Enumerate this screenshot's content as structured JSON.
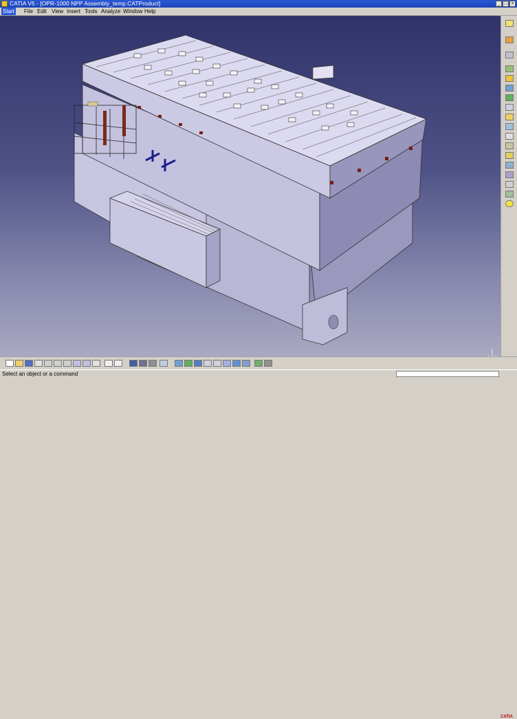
{
  "window": {
    "title": "CATIA V5 - [OPR-1000 NPP Assembly_temp.CATProduct]",
    "buttons": [
      "_",
      "□",
      "×"
    ]
  },
  "menu": [
    {
      "label": "Start"
    },
    {
      "label": "File"
    },
    {
      "label": "Edit"
    },
    {
      "label": "View"
    },
    {
      "label": "Insert"
    },
    {
      "label": "Tools"
    },
    {
      "label": "Analyze"
    },
    {
      "label": "Window"
    },
    {
      "label": "Help"
    }
  ],
  "status": {
    "message": "Select an object or a command",
    "command_input": ""
  },
  "branding": {
    "logo_text": "CATIA"
  },
  "colors": {
    "viewport_top": "#30336a",
    "viewport_bottom": "#a9a9c2",
    "titlebar": "#1d44b8"
  },
  "right_toolbar_icons": [
    "select-icon",
    "sketcher-icon",
    "manipulate-icon",
    "move-icon",
    "snap-icon",
    "explode-icon",
    "clash-icon",
    "fix-icon",
    "constraint-icon",
    "contact-icon",
    "offset-icon",
    "angle-icon",
    "catalog-icon",
    "update-icon",
    "render-icon",
    "light-icon",
    "material-icon",
    "bulb-icon"
  ],
  "bottom_toolbar_icons": [
    "new-icon",
    "open-icon",
    "save-icon",
    "print-icon",
    "cut-icon",
    "copy-icon",
    "paste-icon",
    "undo-icon",
    "redo-icon",
    "whats-this-icon",
    "formula-icon",
    "comment-icon",
    "render-style-icon",
    "hide-show-icon",
    "swap-icon",
    "fly-icon",
    "fit-all-icon",
    "pan-icon",
    "rotate-icon",
    "zoom-in-icon",
    "zoom-out-icon",
    "normal-view-icon",
    "iso-view-icon",
    "shading-icon",
    "hide-icon",
    "swap-space-icon"
  ]
}
